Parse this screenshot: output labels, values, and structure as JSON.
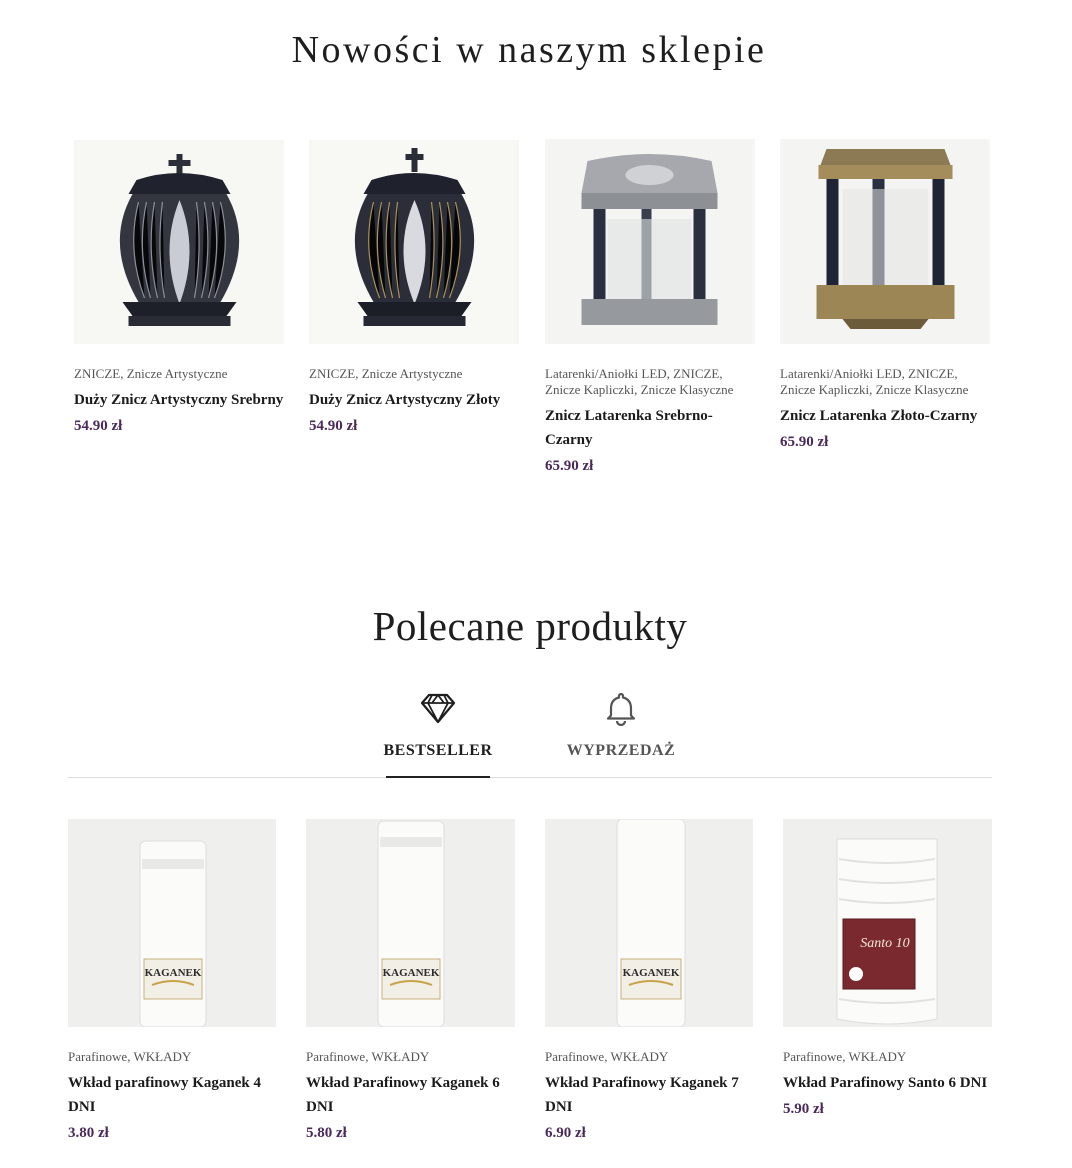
{
  "new_section": {
    "title": "Nowości w naszym sklepie",
    "products": [
      {
        "categories": "ZNICZE, Znicze Artystyczne",
        "name": "Duży Znicz Artystyczny Srebrny",
        "price": "54.90 zł",
        "image": "silver-art-lantern"
      },
      {
        "categories": "ZNICZE, Znicze Artystyczne",
        "name": "Duży Znicz Artystyczny Złoty",
        "price": "54.90 zł",
        "image": "gold-art-lantern"
      },
      {
        "categories": "Latarenki/Aniołki LED, ZNICZE, Znicze Kapliczki, Znicze Klasyczne",
        "name": "Znicz Latarenka Srebrno-Czarny",
        "price": "65.90 zł",
        "image": "silver-black-lantern"
      },
      {
        "categories": "Latarenki/Aniołki LED, ZNICZE, Znicze Kapliczki, Znicze Klasyczne",
        "name": "Znicz Latarenka Złoto-Czarny",
        "price": "65.90 zł",
        "image": "gold-black-lantern"
      }
    ]
  },
  "featured_section": {
    "title": "Polecane produkty",
    "tabs": [
      {
        "label": "BESTSELLER",
        "icon": "diamond-icon",
        "active": true
      },
      {
        "label": "WYPRZEDAŻ",
        "icon": "bell-icon",
        "active": false
      }
    ],
    "products": [
      {
        "categories": "Parafinowe, WKŁADY",
        "name": "Wkład parafinowy Kaganek 4 DNI",
        "price": "3.80 zł",
        "image": "kaganek-4-candle",
        "label_text": "KAGANEK"
      },
      {
        "categories": "Parafinowe, WKŁADY",
        "name": "Wkład Parafinowy Kaganek 6 DNI",
        "price": "5.80 zł",
        "image": "kaganek-6-candle",
        "label_text": "KAGANEK"
      },
      {
        "categories": "Parafinowe, WKŁADY",
        "name": "Wkład Parafinowy Kaganek 7 DNI",
        "price": "6.90 zł",
        "image": "kaganek-7-candle",
        "label_text": "KAGANEK"
      },
      {
        "categories": "Parafinowe, WKŁADY",
        "name": "Wkład Parafinowy Santo 6 DNI",
        "price": "5.90 zł",
        "image": "santo-6-candle",
        "label_text": "Santo 10"
      }
    ]
  },
  "colors": {
    "price": "#4a2a5a",
    "heading": "#1e1e1e",
    "text": "#555555"
  }
}
